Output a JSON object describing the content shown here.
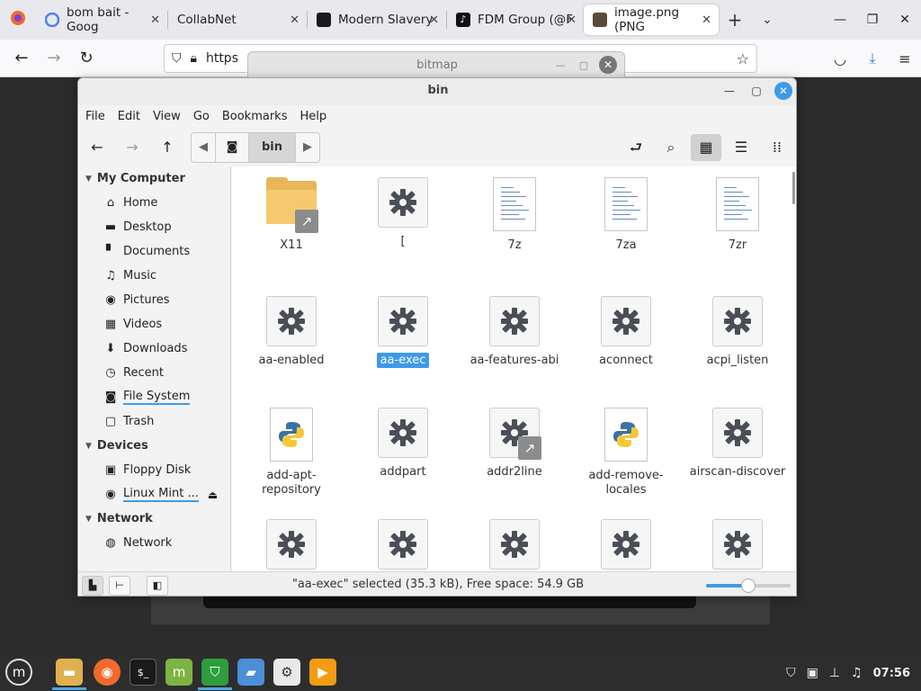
{
  "browser": {
    "tabs": [
      {
        "title": "bom bait - Goog",
        "favicon": "google-icon",
        "color": "#ffffff"
      },
      {
        "title": "CollabNet",
        "favicon": "",
        "color": "#e9e9ed"
      },
      {
        "title": "Modern Slavery",
        "favicon": "site-icon",
        "color": "#1a1a1a"
      },
      {
        "title": "FDM Group (@F",
        "favicon": "tiktok-icon",
        "color": "#111111"
      },
      {
        "title": "image.png (PNG",
        "favicon": "image-icon",
        "color": "#5a4a3a"
      }
    ],
    "url_text": "https"
  },
  "bitmap_window": {
    "title": "bitmap"
  },
  "file_manager": {
    "title": "bin",
    "menu": [
      "File",
      "Edit",
      "View",
      "Go",
      "Bookmarks",
      "Help"
    ],
    "path": {
      "current": "bin"
    },
    "sidebar": {
      "sections": [
        {
          "heading": "My Computer",
          "items": [
            {
              "label": "Home",
              "icon": "home-icon",
              "glyph": "⌂"
            },
            {
              "label": "Desktop",
              "icon": "desktop-icon",
              "glyph": "▬"
            },
            {
              "label": "Documents",
              "icon": "documents-icon",
              "glyph": "▘"
            },
            {
              "label": "Music",
              "icon": "music-icon",
              "glyph": "♫"
            },
            {
              "label": "Pictures",
              "icon": "pictures-icon",
              "glyph": "◉"
            },
            {
              "label": "Videos",
              "icon": "videos-icon",
              "glyph": "▦"
            },
            {
              "label": "Downloads",
              "icon": "downloads-icon",
              "glyph": "⬇"
            },
            {
              "label": "Recent",
              "icon": "recent-icon",
              "glyph": "◷"
            },
            {
              "label": "File System",
              "icon": "filesystem-icon",
              "glyph": "◙",
              "active": true
            },
            {
              "label": "Trash",
              "icon": "trash-icon",
              "glyph": "▢"
            }
          ]
        },
        {
          "heading": "Devices",
          "items": [
            {
              "label": "Floppy Disk",
              "icon": "floppy-icon",
              "glyph": "▣"
            },
            {
              "label": "Linux Mint ...",
              "icon": "disc-icon",
              "glyph": "◉",
              "eject": true
            }
          ]
        },
        {
          "heading": "Network",
          "items": [
            {
              "label": "Network",
              "icon": "network-icon",
              "glyph": "◍"
            }
          ]
        }
      ]
    },
    "files": [
      {
        "name": "X11",
        "type": "folder-link"
      },
      {
        "name": "[",
        "type": "exec"
      },
      {
        "name": "7z",
        "type": "doc"
      },
      {
        "name": "7za",
        "type": "doc"
      },
      {
        "name": "7zr",
        "type": "doc"
      },
      {
        "name": "aa-enabled",
        "type": "exec"
      },
      {
        "name": "aa-exec",
        "type": "exec",
        "selected": true
      },
      {
        "name": "aa-features-abi",
        "type": "exec"
      },
      {
        "name": "aconnect",
        "type": "exec"
      },
      {
        "name": "acpi_listen",
        "type": "exec"
      },
      {
        "name": "add-apt-\nrepository",
        "type": "python"
      },
      {
        "name": "addpart",
        "type": "exec"
      },
      {
        "name": "addr2line",
        "type": "exec-link"
      },
      {
        "name": "add-remove-\nlocales",
        "type": "python"
      },
      {
        "name": "airscan-discover",
        "type": "exec"
      },
      {
        "name": "",
        "type": "exec"
      },
      {
        "name": "",
        "type": "exec"
      },
      {
        "name": "",
        "type": "exec"
      },
      {
        "name": "",
        "type": "exec"
      },
      {
        "name": "",
        "type": "exec"
      }
    ],
    "status": "\"aa-exec\" selected (35.3 kB), Free space: 54.9 GB",
    "zoom_level": 0.5
  },
  "taskbar": {
    "apps": [
      {
        "name": "mint-menu",
        "color": "#2d2d2d"
      },
      {
        "name": "files",
        "color": "#e0b050",
        "active": true
      },
      {
        "name": "firefox",
        "color": "#f06a2c"
      },
      {
        "name": "terminal",
        "color": "#1a1a1a"
      },
      {
        "name": "mintupdate",
        "color": "#7cb342"
      },
      {
        "name": "vpn",
        "color": "#2e9d3c",
        "active": true
      },
      {
        "name": "folder-blue",
        "color": "#4a8fd8"
      },
      {
        "name": "settings",
        "color": "#e8e8e8"
      },
      {
        "name": "media",
        "color": "#f39c12"
      }
    ],
    "clock": "07:56"
  },
  "colors": {
    "accent": "#3d9ae8",
    "folder": "#e8b55a"
  }
}
